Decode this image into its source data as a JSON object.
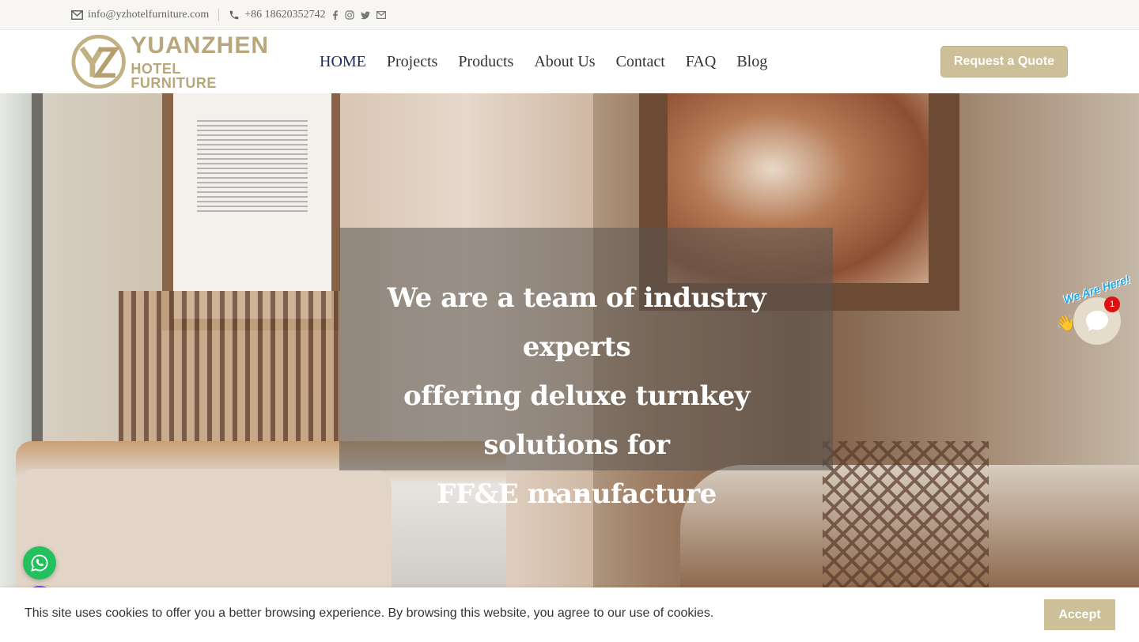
{
  "topbar": {
    "email": "info@yzhotelfurniture.com",
    "phone": "+86 18620352742",
    "social_icons": [
      "facebook-icon",
      "instagram-icon",
      "twitter-icon",
      "mail-icon"
    ]
  },
  "header": {
    "logo_line1": "YUANZHEN",
    "logo_line2": "HOTEL FURNITURE",
    "nav": [
      "HOME",
      "Projects",
      "Products",
      "About Us",
      "Contact",
      "FAQ",
      "Blog"
    ],
    "active_nav": "HOME",
    "quote_button": "Request a Quote"
  },
  "hero": {
    "headline_lines": [
      "We are a team of industry experts",
      "offering deluxe turnkey solutions for",
      "FF&E manufacture"
    ],
    "slide_count": 2
  },
  "chat": {
    "label": "We Are Here!",
    "badge_count": "1"
  },
  "cookie": {
    "message": "This site uses cookies to offer you a better browsing experience. By browsing this website, you agree to our use of cookies.",
    "accept_label": "Accept"
  },
  "colors": {
    "accent": "#cdbf98",
    "logo_gold": "#b8a77a",
    "nav_active": "#1d2b5e",
    "whatsapp": "#22c15e",
    "mail_fab": "#6a3ff0"
  }
}
